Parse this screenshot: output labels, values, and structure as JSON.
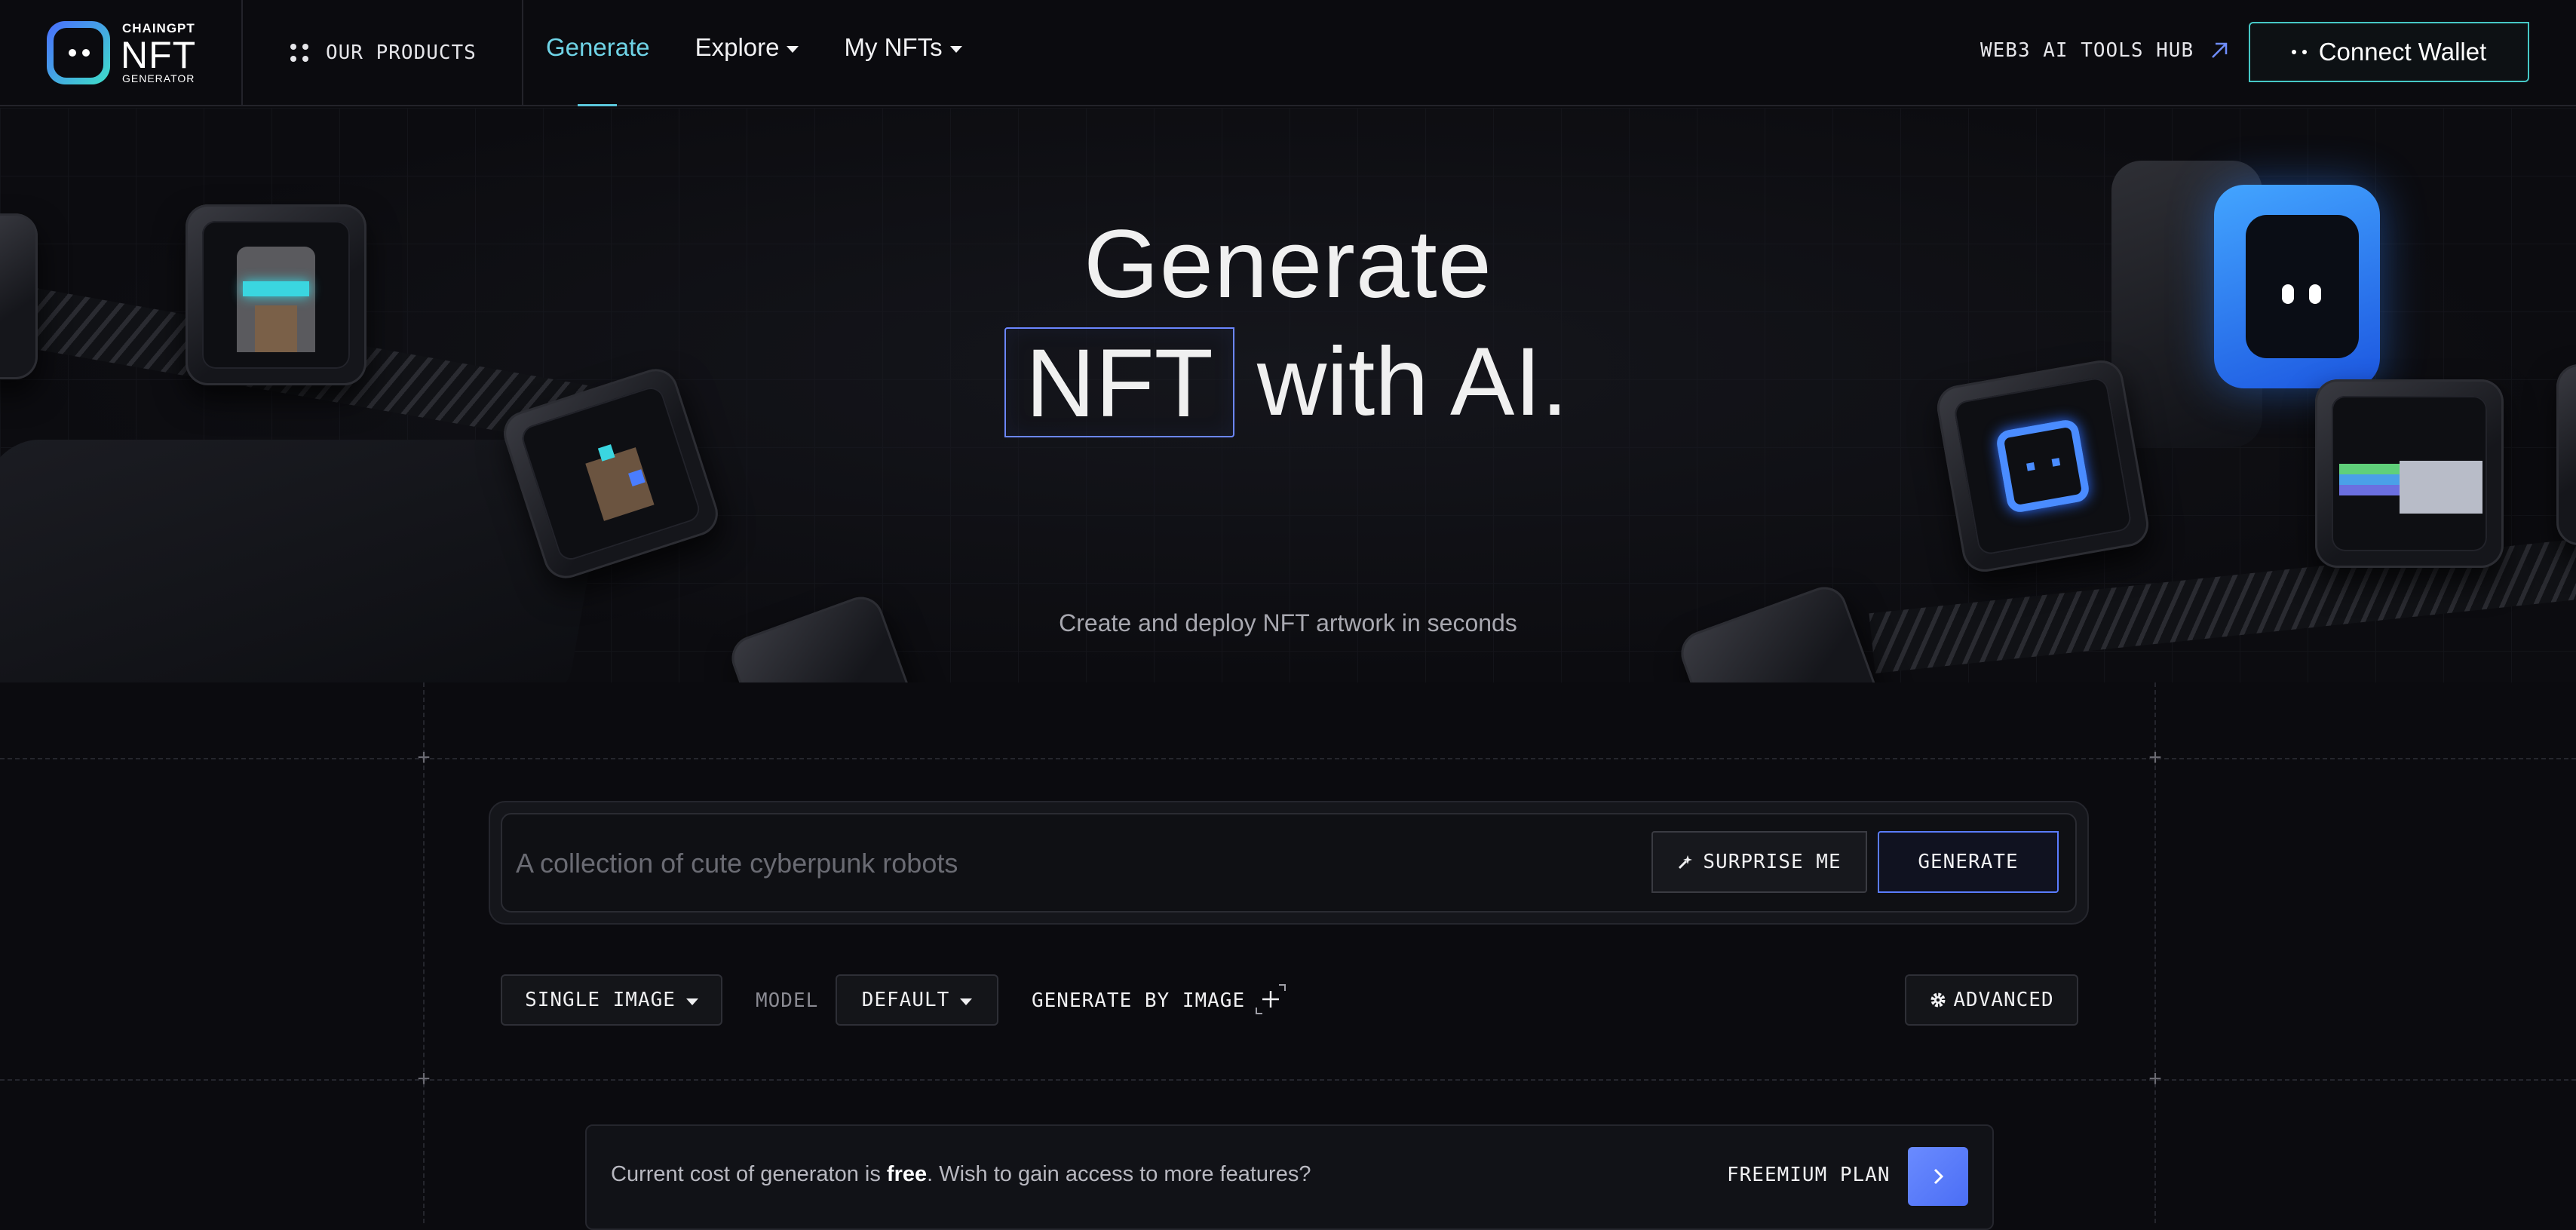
{
  "nav": {
    "logo_top": "CHAINGPT",
    "logo_main": "NFT",
    "logo_bottom": "GENERATOR",
    "products_label": "OUR PRODUCTS",
    "links": [
      {
        "label": "Generate",
        "active": true
      },
      {
        "label": "Explore",
        "dropdown": true
      },
      {
        "label": "My NFTs",
        "dropdown": true
      }
    ],
    "hub_label": "WEB3 AI TOOLS HUB",
    "connect_label": "Connect Wallet"
  },
  "hero": {
    "title_line1": "Generate",
    "title_nft": "NFT",
    "title_rest": "with AI.",
    "subtitle": "Create and deploy NFT artwork in seconds"
  },
  "prompt": {
    "placeholder": "A collection of cute cyberpunk robots",
    "surprise_label": "SURPRISE ME",
    "generate_label": "GENERATE"
  },
  "options": {
    "mode_label": "SINGLE IMAGE",
    "model_caption": "MODEL",
    "model_value": "DEFAULT",
    "by_image_label": "GENERATE BY IMAGE",
    "advanced_label": "ADVANCED"
  },
  "cost": {
    "text_before": "Current cost of generaton is ",
    "text_bold": "free",
    "text_after": ". Wish to gain access to more features?",
    "plan_label": "FREEMIUM PLAN"
  },
  "colors": {
    "accent_cyan": "#6fd3e6",
    "accent_blue": "#5a7cff",
    "background": "#0b0b0f"
  }
}
